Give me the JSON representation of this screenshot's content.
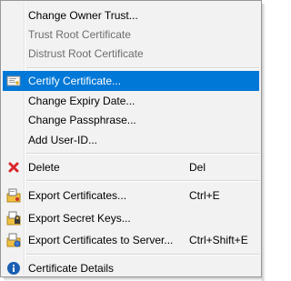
{
  "menu": {
    "change_owner_trust": "Change Owner Trust...",
    "trust_root": "Trust Root Certificate",
    "distrust_root": "Distrust Root Certificate",
    "certify": "Certify Certificate...",
    "change_expiry": "Change Expiry Date...",
    "change_passphrase": "Change Passphrase...",
    "add_user_id": "Add User-ID...",
    "delete": "Delete",
    "delete_shortcut": "Del",
    "export_certs": "Export Certificates...",
    "export_certs_shortcut": "Ctrl+E",
    "export_secret": "Export Secret Keys...",
    "export_server": "Export Certificates to Server...",
    "export_server_shortcut": "Ctrl+Shift+E",
    "details": "Certificate Details"
  },
  "state": {
    "highlighted_item": "certify",
    "disabled_items": [
      "trust_root",
      "distrust_root"
    ]
  },
  "colors": {
    "highlight": "#0078d7",
    "menu_bg": "#f2f2f2",
    "disabled_text": "#6d6d6d",
    "delete_icon": "#d9262c",
    "info_icon": "#1a5fb4"
  },
  "icons": {
    "certify": "certificate-icon",
    "delete": "red-x-icon",
    "export_certs": "export-certificate-icon",
    "export_secret": "export-secret-key-icon",
    "export_server": "export-to-server-icon",
    "details": "info-icon"
  }
}
